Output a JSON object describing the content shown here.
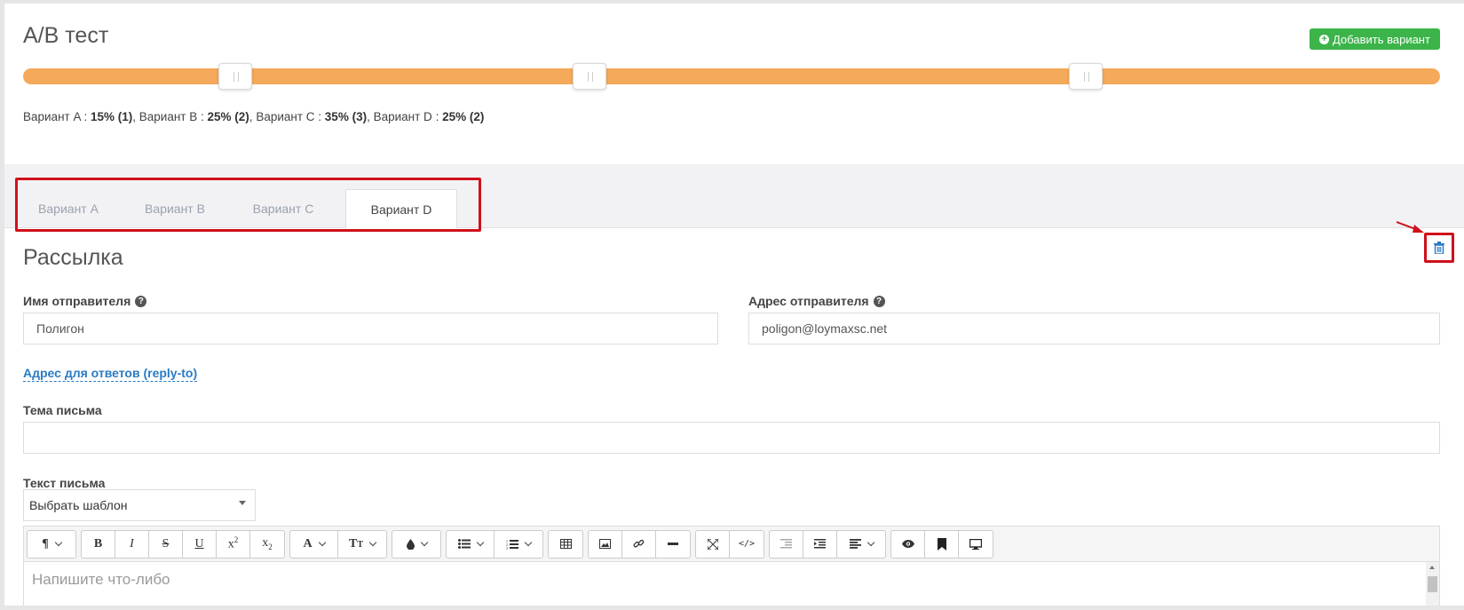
{
  "ab_test": {
    "title": "A/B тест",
    "add_button_label": "Добавить вариант",
    "split": [
      {
        "label": "Вариант A",
        "value": "15% (1)"
      },
      {
        "label": "Вариант B",
        "value": "25% (2)"
      },
      {
        "label": "Вариант C",
        "value": "35% (3)"
      },
      {
        "label": "Вариант D",
        "value": "25% (2)"
      }
    ],
    "slider_handles_percent": [
      15,
      40,
      75
    ]
  },
  "tabs": [
    {
      "label": "Вариант A",
      "active": false
    },
    {
      "label": "Вариант B",
      "active": false
    },
    {
      "label": "Вариант C",
      "active": false
    },
    {
      "label": "Вариант D",
      "active": true
    }
  ],
  "mailing": {
    "title": "Рассылка",
    "sender_name_label": "Имя отправителя",
    "sender_name_value": "Полигон",
    "sender_address_label": "Адрес отправителя",
    "sender_address_value": "poligon@loymaxsc.net",
    "reply_to_link": "Адрес для ответов (reply-to)",
    "subject_label": "Тема письма",
    "subject_value": "",
    "body_label": "Текст письма",
    "template_select_value": "Выбрать шаблон",
    "editor_placeholder": "Напишите что-либо"
  },
  "colors": {
    "slider": "#f5a95a",
    "add_button": "#3cb44a",
    "highlight": "#d0101a",
    "link": "#2a7bc4"
  }
}
